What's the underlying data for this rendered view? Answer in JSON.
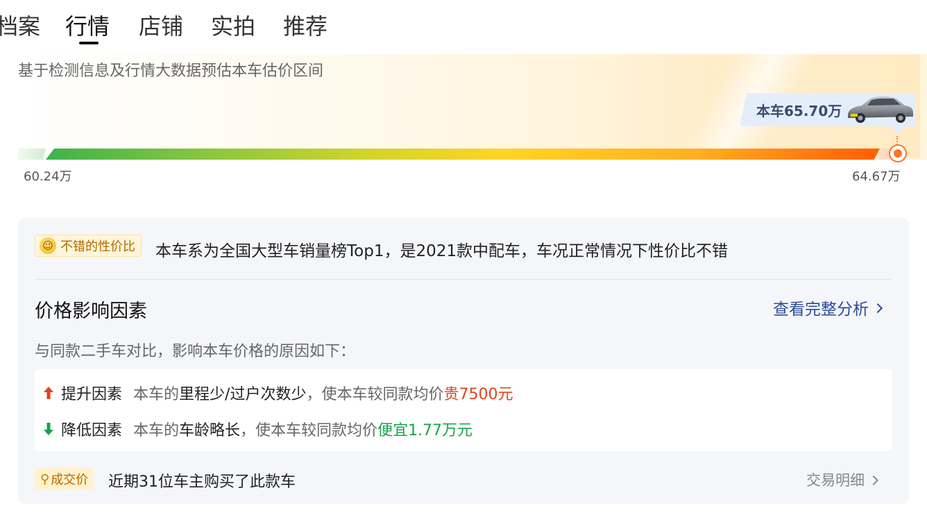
{
  "tabs": [
    {
      "label": "档案"
    },
    {
      "label": "行情",
      "active": true
    },
    {
      "label": "店铺"
    },
    {
      "label": "实拍"
    },
    {
      "label": "推荐"
    }
  ],
  "valuation": {
    "subtitle": "基于检测信息及行情大数据预估本车估价区间",
    "car_price_label": "本车65.70万",
    "range_low": "60.24万",
    "range_high": "64.67万"
  },
  "summary": {
    "badge": "不错的性价比",
    "badge_icon": "smile-icon",
    "text": "本车系为全国大型车销量榜Top1，是2021款中配车，车况正常情况下性价比不错"
  },
  "price_factors": {
    "title": "价格影响因素",
    "link_label": "查看完整分析",
    "compare_note": "与同款二手车对比，影响本车价格的原因如下：",
    "up": {
      "label": "提升因素",
      "prefix": "本车的",
      "highlight": "里程少/过户次数少",
      "middle": "，使本车较同款均价",
      "impact": "贵7500元"
    },
    "down": {
      "label": "降低因素",
      "prefix": "本车的",
      "highlight": "车龄略长",
      "middle": "，使本车较同款均价",
      "impact": "便宜1.77万元"
    }
  },
  "deals": {
    "badge": "成交价",
    "text": "近期31位车主购买了此款车",
    "link_label": "交易明细"
  },
  "colors": {
    "accent_link": "#2e4a9a",
    "up": "#e2431a",
    "down": "#17a34a",
    "marker": "#ff7426"
  }
}
